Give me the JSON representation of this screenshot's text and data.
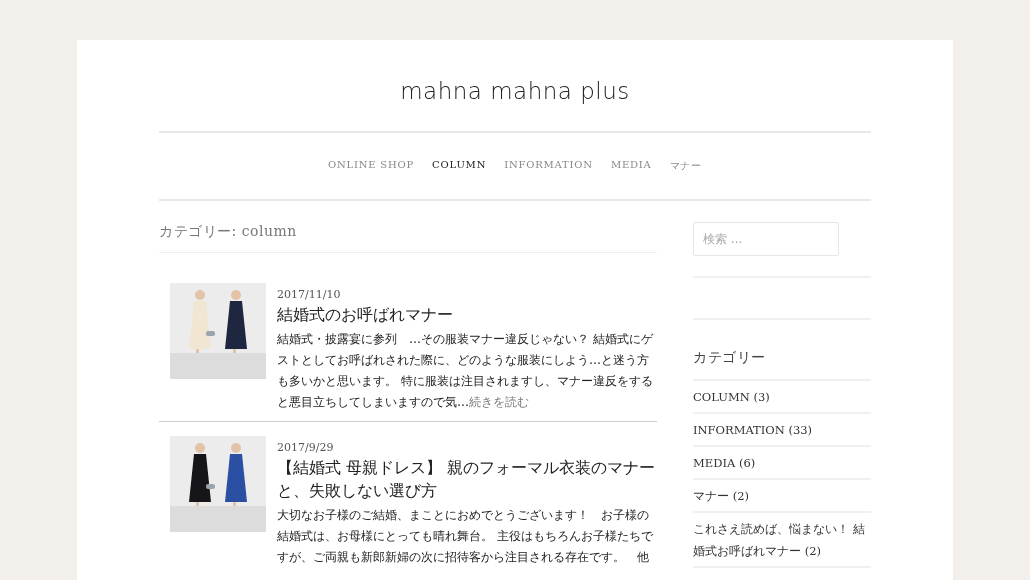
{
  "site_title": "mahna mahna plus",
  "nav": [
    {
      "label": "ONLINE SHOP",
      "selected": false
    },
    {
      "label": "COLUMN",
      "selected": true
    },
    {
      "label": "INFORMATION",
      "selected": false
    },
    {
      "label": "MEDIA",
      "selected": false
    },
    {
      "label": "マナー",
      "selected": false
    }
  ],
  "archive_title": "カテゴリー: column",
  "posts": [
    {
      "date": "2017/11/10",
      "title": "結婚式のお呼ばれマナー",
      "excerpt": "結婚式・披露宴に参列　…その服装マナー違反じゃない？ 結婚式にゲストとしてお呼ばれされた際に、どのような服装にしよう…と迷う方も多いかと思います。 特に服装は注目されますし、マナー違反をすると悪目立ちしてしまいますので気…",
      "more_link": "続きを読む"
    },
    {
      "date": "2017/9/29",
      "title": "【結婚式 母親ドレス】 親のフォーマル衣装のマナーと、失敗しない選び方",
      "excerpt": "大切なお子様のご結婚、まことにおめでとうございます！　お子様の結婚式は、お母様にとっても晴れ舞台。 主役はもちろんお子様たちですが、ご両親も新郎新婦の次に招待客から注目される存在です。　他"
    }
  ],
  "sidebar": {
    "search": {
      "placeholder": "検索 ..."
    },
    "categories_title": "カテゴリー",
    "categories": [
      "COLUMN (3)",
      "INFORMATION (33)",
      "MEDIA (6)",
      "マナー (2)",
      "これさえ読めば、悩まない！ 結婚式お呼ばれマナー (2)"
    ]
  }
}
